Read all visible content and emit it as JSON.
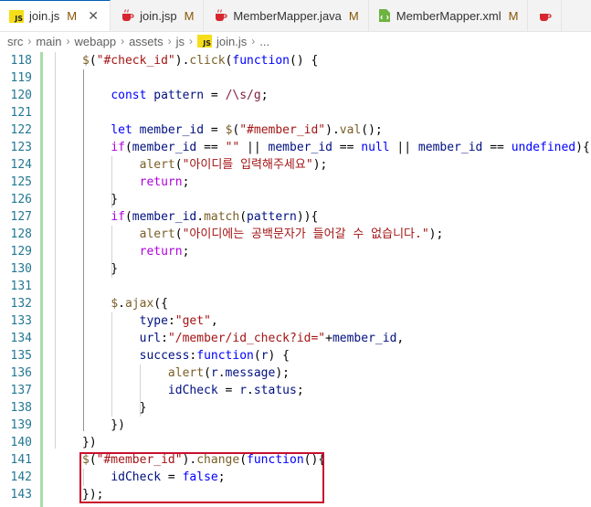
{
  "tabs": [
    {
      "label": "join.js",
      "modified": "M",
      "icon": "js-icon",
      "active": true
    },
    {
      "label": "join.jsp",
      "modified": "M",
      "icon": "java-icon",
      "active": false
    },
    {
      "label": "MemberMapper.java",
      "modified": "M",
      "icon": "java-icon",
      "active": false
    },
    {
      "label": "MemberMapper.xml",
      "modified": "M",
      "icon": "xml-icon",
      "active": false
    }
  ],
  "breadcrumb": {
    "items": [
      "src",
      "main",
      "webapp",
      "assets",
      "js",
      "join.js",
      "..."
    ]
  },
  "code": {
    "line_numbers": [
      "118",
      "119",
      "120",
      "121",
      "122",
      "123",
      "124",
      "125",
      "126",
      "127",
      "128",
      "129",
      "130",
      "131",
      "132",
      "133",
      "134",
      "135",
      "136",
      "137",
      "138",
      "139",
      "140",
      "141",
      "142",
      "143"
    ],
    "lines": [
      "$(\"#check_id\").click(function() {",
      "",
      "    const pattern = /\\s/g;",
      "",
      "    let member_id = $(\"#member_id\").val();",
      "    if(member_id == \"\" || member_id == null || member_id == undefined){",
      "        alert(\"아이디를 입력해주세요\");",
      "        return;",
      "    }",
      "    if(member_id.match(pattern)){",
      "        alert(\"아이디에는 공백문자가 들어갈 수 없습니다.\");",
      "        return;",
      "    }",
      "",
      "    $.ajax({",
      "        type:\"get\",",
      "        url:\"/member/id_check?id=\"+member_id,",
      "        success:function(r) {",
      "            alert(r.message);",
      "            idCheck = r.status;",
      "        }",
      "    })",
      "})",
      "$(\"#member_id\").change(function(){",
      "    idCheck = false;",
      "});"
    ]
  },
  "colors": {
    "accent": "#005fb8",
    "highlight_box": "#c8102e",
    "line_number": "#237893"
  }
}
